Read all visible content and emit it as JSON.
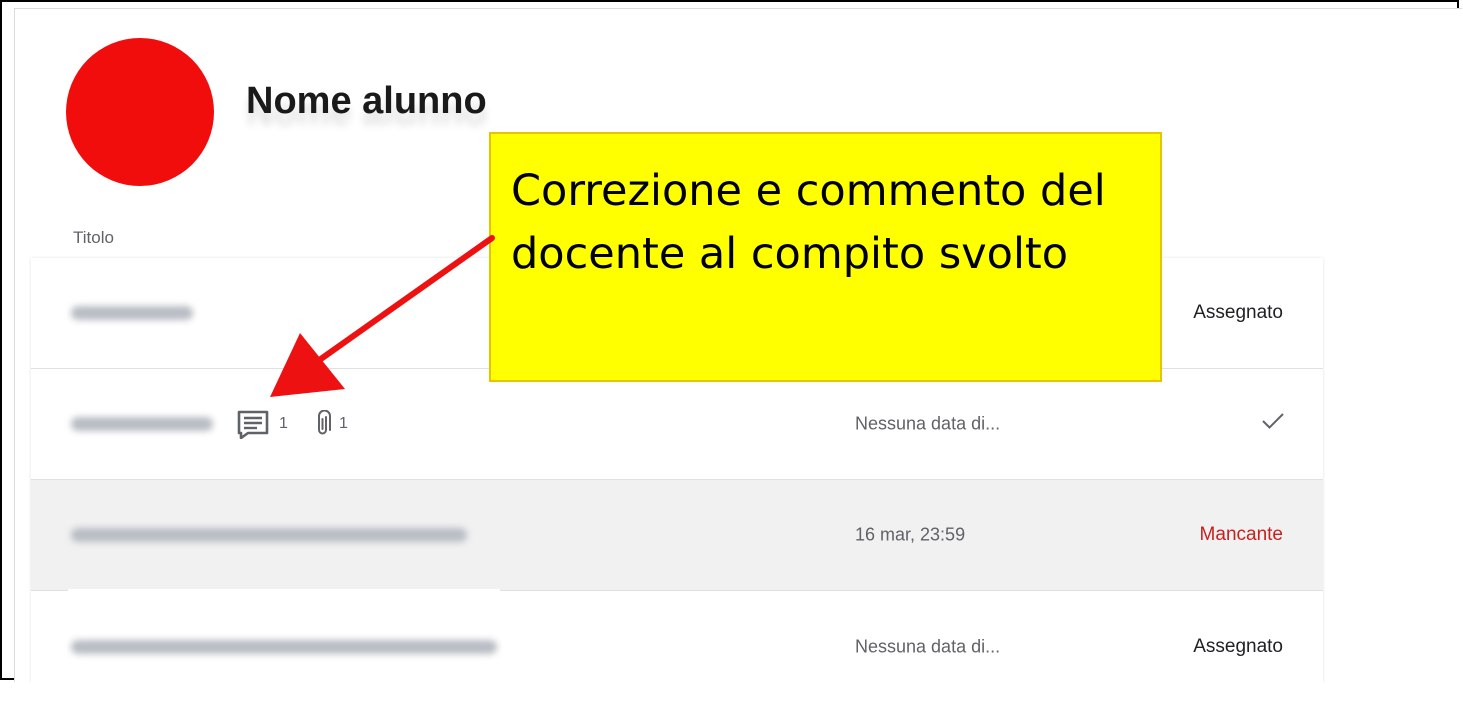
{
  "student": {
    "name": "Nome alunno",
    "avatar_color": "#f20d0d"
  },
  "list": {
    "column_title": "Titolo",
    "rows": [
      {
        "title": "",
        "due": "",
        "status": "Assegnato"
      },
      {
        "title": "",
        "comments": "1",
        "attachments": "1",
        "due": "Nessuna data di...",
        "status_icon": "checkmark-icon"
      },
      {
        "title": "",
        "due": "16 mar, 23:59",
        "status": "Mancante",
        "status_color": "#c5221f"
      },
      {
        "title": "",
        "due": "Nessuna data di...",
        "status": "Assegnato"
      }
    ]
  },
  "annotation": {
    "text": "Correzione e commento del docente al compito svolto",
    "background": "#ffff00",
    "arrow_color": "#ee1111"
  }
}
